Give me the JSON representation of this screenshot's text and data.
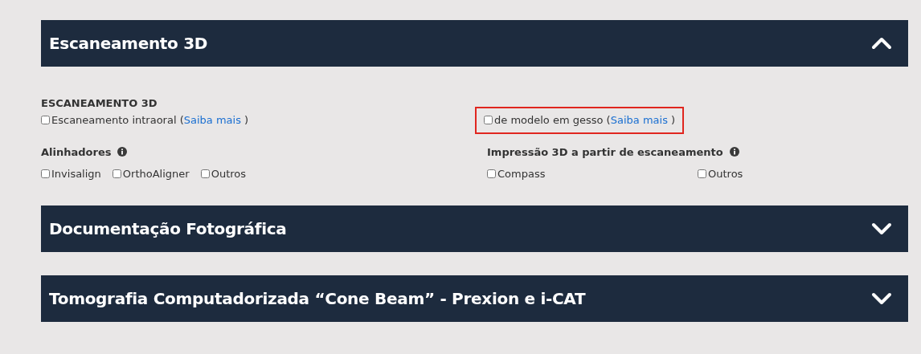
{
  "sections": [
    {
      "title": "Escaneamento 3D",
      "expanded": true,
      "heading": "ESCANEAMENTO 3D",
      "scan_options": [
        {
          "label": "Escaneamento intraoral (",
          "link": "Saiba mais",
          "after": " )",
          "checked": false,
          "highlighted": false
        },
        {
          "label": "de modelo em gesso (",
          "link": "Saiba mais",
          "after": " )",
          "checked": false,
          "highlighted": true
        }
      ],
      "groups": [
        {
          "title": "Alinhadores",
          "options": [
            {
              "label": "Invisalign",
              "checked": false
            },
            {
              "label": "OrthoAligner",
              "checked": false
            },
            {
              "label": "Outros",
              "checked": false
            }
          ]
        },
        {
          "title": "Impressão 3D a partir de escaneamento",
          "options": [
            {
              "label": "Compass",
              "checked": false
            },
            {
              "label": "Outros",
              "checked": false
            }
          ]
        }
      ]
    },
    {
      "title": "Documentação Fotográfica",
      "expanded": false
    },
    {
      "title": "Tomografia Computadorizada “Cone Beam” - Prexion e i-CAT",
      "expanded": false
    }
  ]
}
